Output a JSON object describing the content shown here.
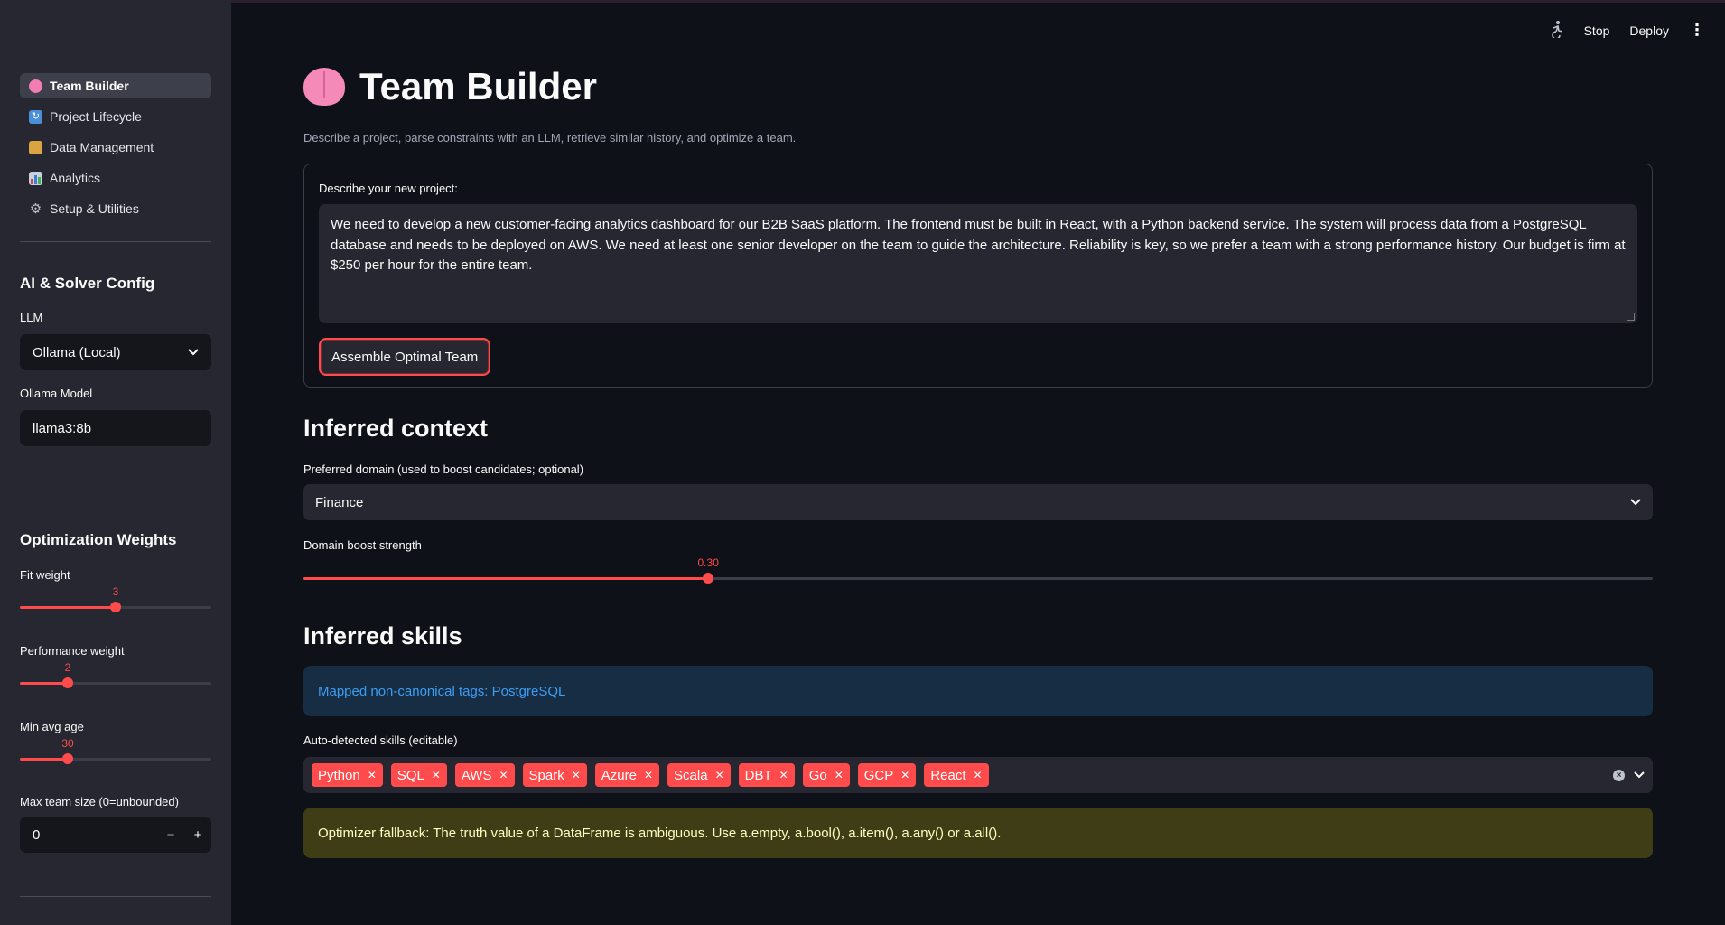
{
  "sidebar": {
    "nav": [
      {
        "label": "Team Builder",
        "icon": "brain-icon"
      },
      {
        "label": "Project Lifecycle",
        "icon": "cycle-icon"
      },
      {
        "label": "Data Management",
        "icon": "card-file-icon"
      },
      {
        "label": "Analytics",
        "icon": "bar-chart-icon"
      },
      {
        "label": "Setup & Utilities",
        "icon": "gear-icon"
      }
    ],
    "ai_config": {
      "heading": "AI & Solver Config",
      "llm_label": "LLM",
      "llm_value": "Ollama (Local)",
      "model_label": "Ollama Model",
      "model_value": "llama3:8b"
    },
    "weights": {
      "heading": "Optimization Weights",
      "fit": {
        "label": "Fit weight",
        "value": "3",
        "fraction": 0.5
      },
      "performance": {
        "label": "Performance weight",
        "value": "2",
        "fraction": 0.25
      },
      "min_age": {
        "label": "Min avg age",
        "value": "30",
        "fraction": 0.25
      },
      "max_team": {
        "label": "Max team size (0=unbounded)",
        "value": "0",
        "minus": "−",
        "plus": "+"
      }
    }
  },
  "toolbar": {
    "stop": "Stop",
    "deploy": "Deploy",
    "menu": "⋮"
  },
  "main": {
    "title": "Team Builder",
    "subtitle": "Describe a project, parse constraints with an LLM, retrieve similar history, and optimize a team.",
    "form": {
      "label": "Describe your new project:",
      "text": "We need to develop a new customer-facing analytics dashboard for our B2B SaaS platform. The frontend must be built in React, with a Python backend service. The system will process data from a PostgreSQL database and needs to be deployed on AWS. We need at least one senior developer on the team to guide the architecture. Reliability is key, so we prefer a team with a strong performance history. Our budget is firm at $250 per hour for the entire team.",
      "button": "Assemble Optimal Team"
    },
    "context": {
      "heading": "Inferred context",
      "domain_label": "Preferred domain (used to boost candidates; optional)",
      "domain_value": "Finance",
      "boost_label": "Domain boost strength",
      "boost_value": "0.30",
      "boost_fraction": 0.3
    },
    "skills": {
      "heading": "Inferred skills",
      "info": "Mapped non-canonical tags: PostgreSQL",
      "auto_label": "Auto-detected skills (editable)",
      "tags": [
        "Python",
        "SQL",
        "AWS",
        "Spark",
        "Azure",
        "Scala",
        "DBT",
        "Go",
        "GCP",
        "React"
      ],
      "warning": "Optimizer fallback: The truth value of a DataFrame is ambiguous. Use a.empty, a.bool(), a.item(), a.any() or a.all()."
    }
  },
  "colors": {
    "accent": "#ff4b4b",
    "info_text": "#3d9df3",
    "warning_text": "#ffffc2"
  }
}
